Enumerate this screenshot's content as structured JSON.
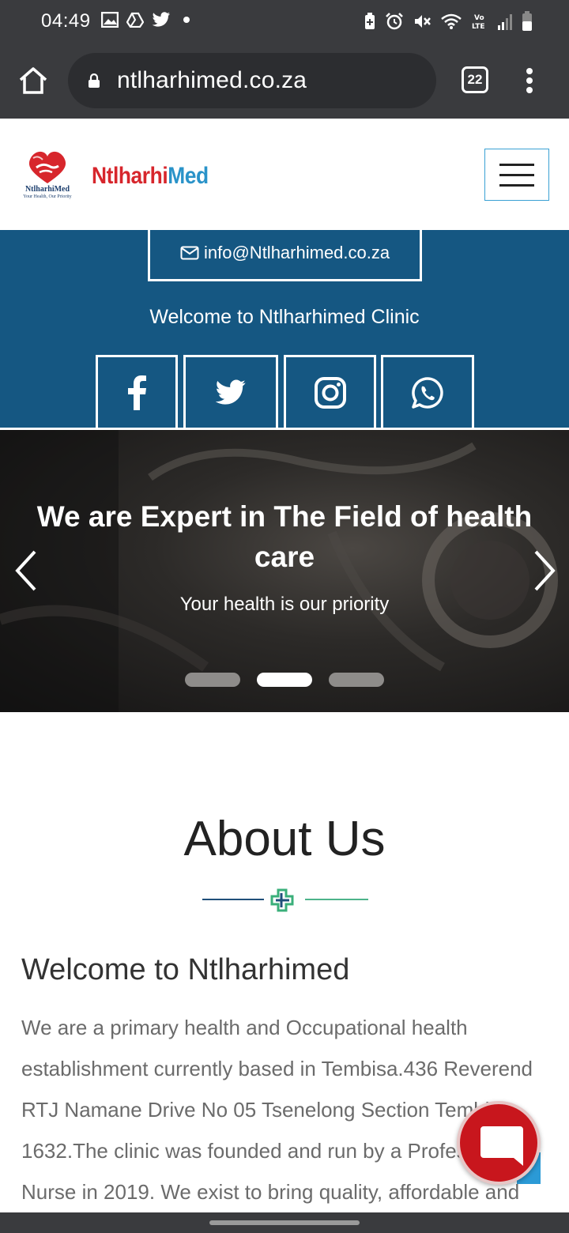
{
  "status_bar": {
    "time": "04:49",
    "left_icons": [
      "gallery-icon",
      "drive-icon",
      "twitter-icon",
      "notification-dot"
    ],
    "right_icons": [
      "battery-saver-icon",
      "alarm-icon",
      "mute-icon",
      "wifi-icon",
      "volte-icon",
      "signal-icon",
      "battery-icon"
    ]
  },
  "browser": {
    "url": "ntlharhimed.co.za",
    "tab_count": "22"
  },
  "header": {
    "logo_name": "NtlharhiMed",
    "logo_tagline": "Your Health, Our Priority",
    "brand_part1": "Ntlharhi",
    "brand_part2": "Med",
    "brand_colors": {
      "red": "#d7262c",
      "blue": "#2a93c9"
    }
  },
  "info_band": {
    "email": "info@Ntlharhimed.co.za",
    "welcome": "Welcome to Ntlharhimed Clinic",
    "social": [
      "facebook-icon",
      "twitter-icon",
      "instagram-icon",
      "whatsapp-icon"
    ],
    "background": "#155782"
  },
  "hero": {
    "title": "We are Expert in The Field of health care",
    "subtitle": "Your health is our priority",
    "slides": 3,
    "active_slide": 2
  },
  "about": {
    "title": "About Us",
    "heading": "Welcome to Ntlharhimed",
    "body": "We are a primary health and Occupational health establishment currently based in Tembisa.436 Reverend RTJ Namane Drive No 05 Tsenelong Section Tembisa 1632.The clinic was founded and run by a Professional Nurse in 2019. We exist to bring quality, affordable and"
  },
  "chat": {
    "color": "#c8161d"
  }
}
